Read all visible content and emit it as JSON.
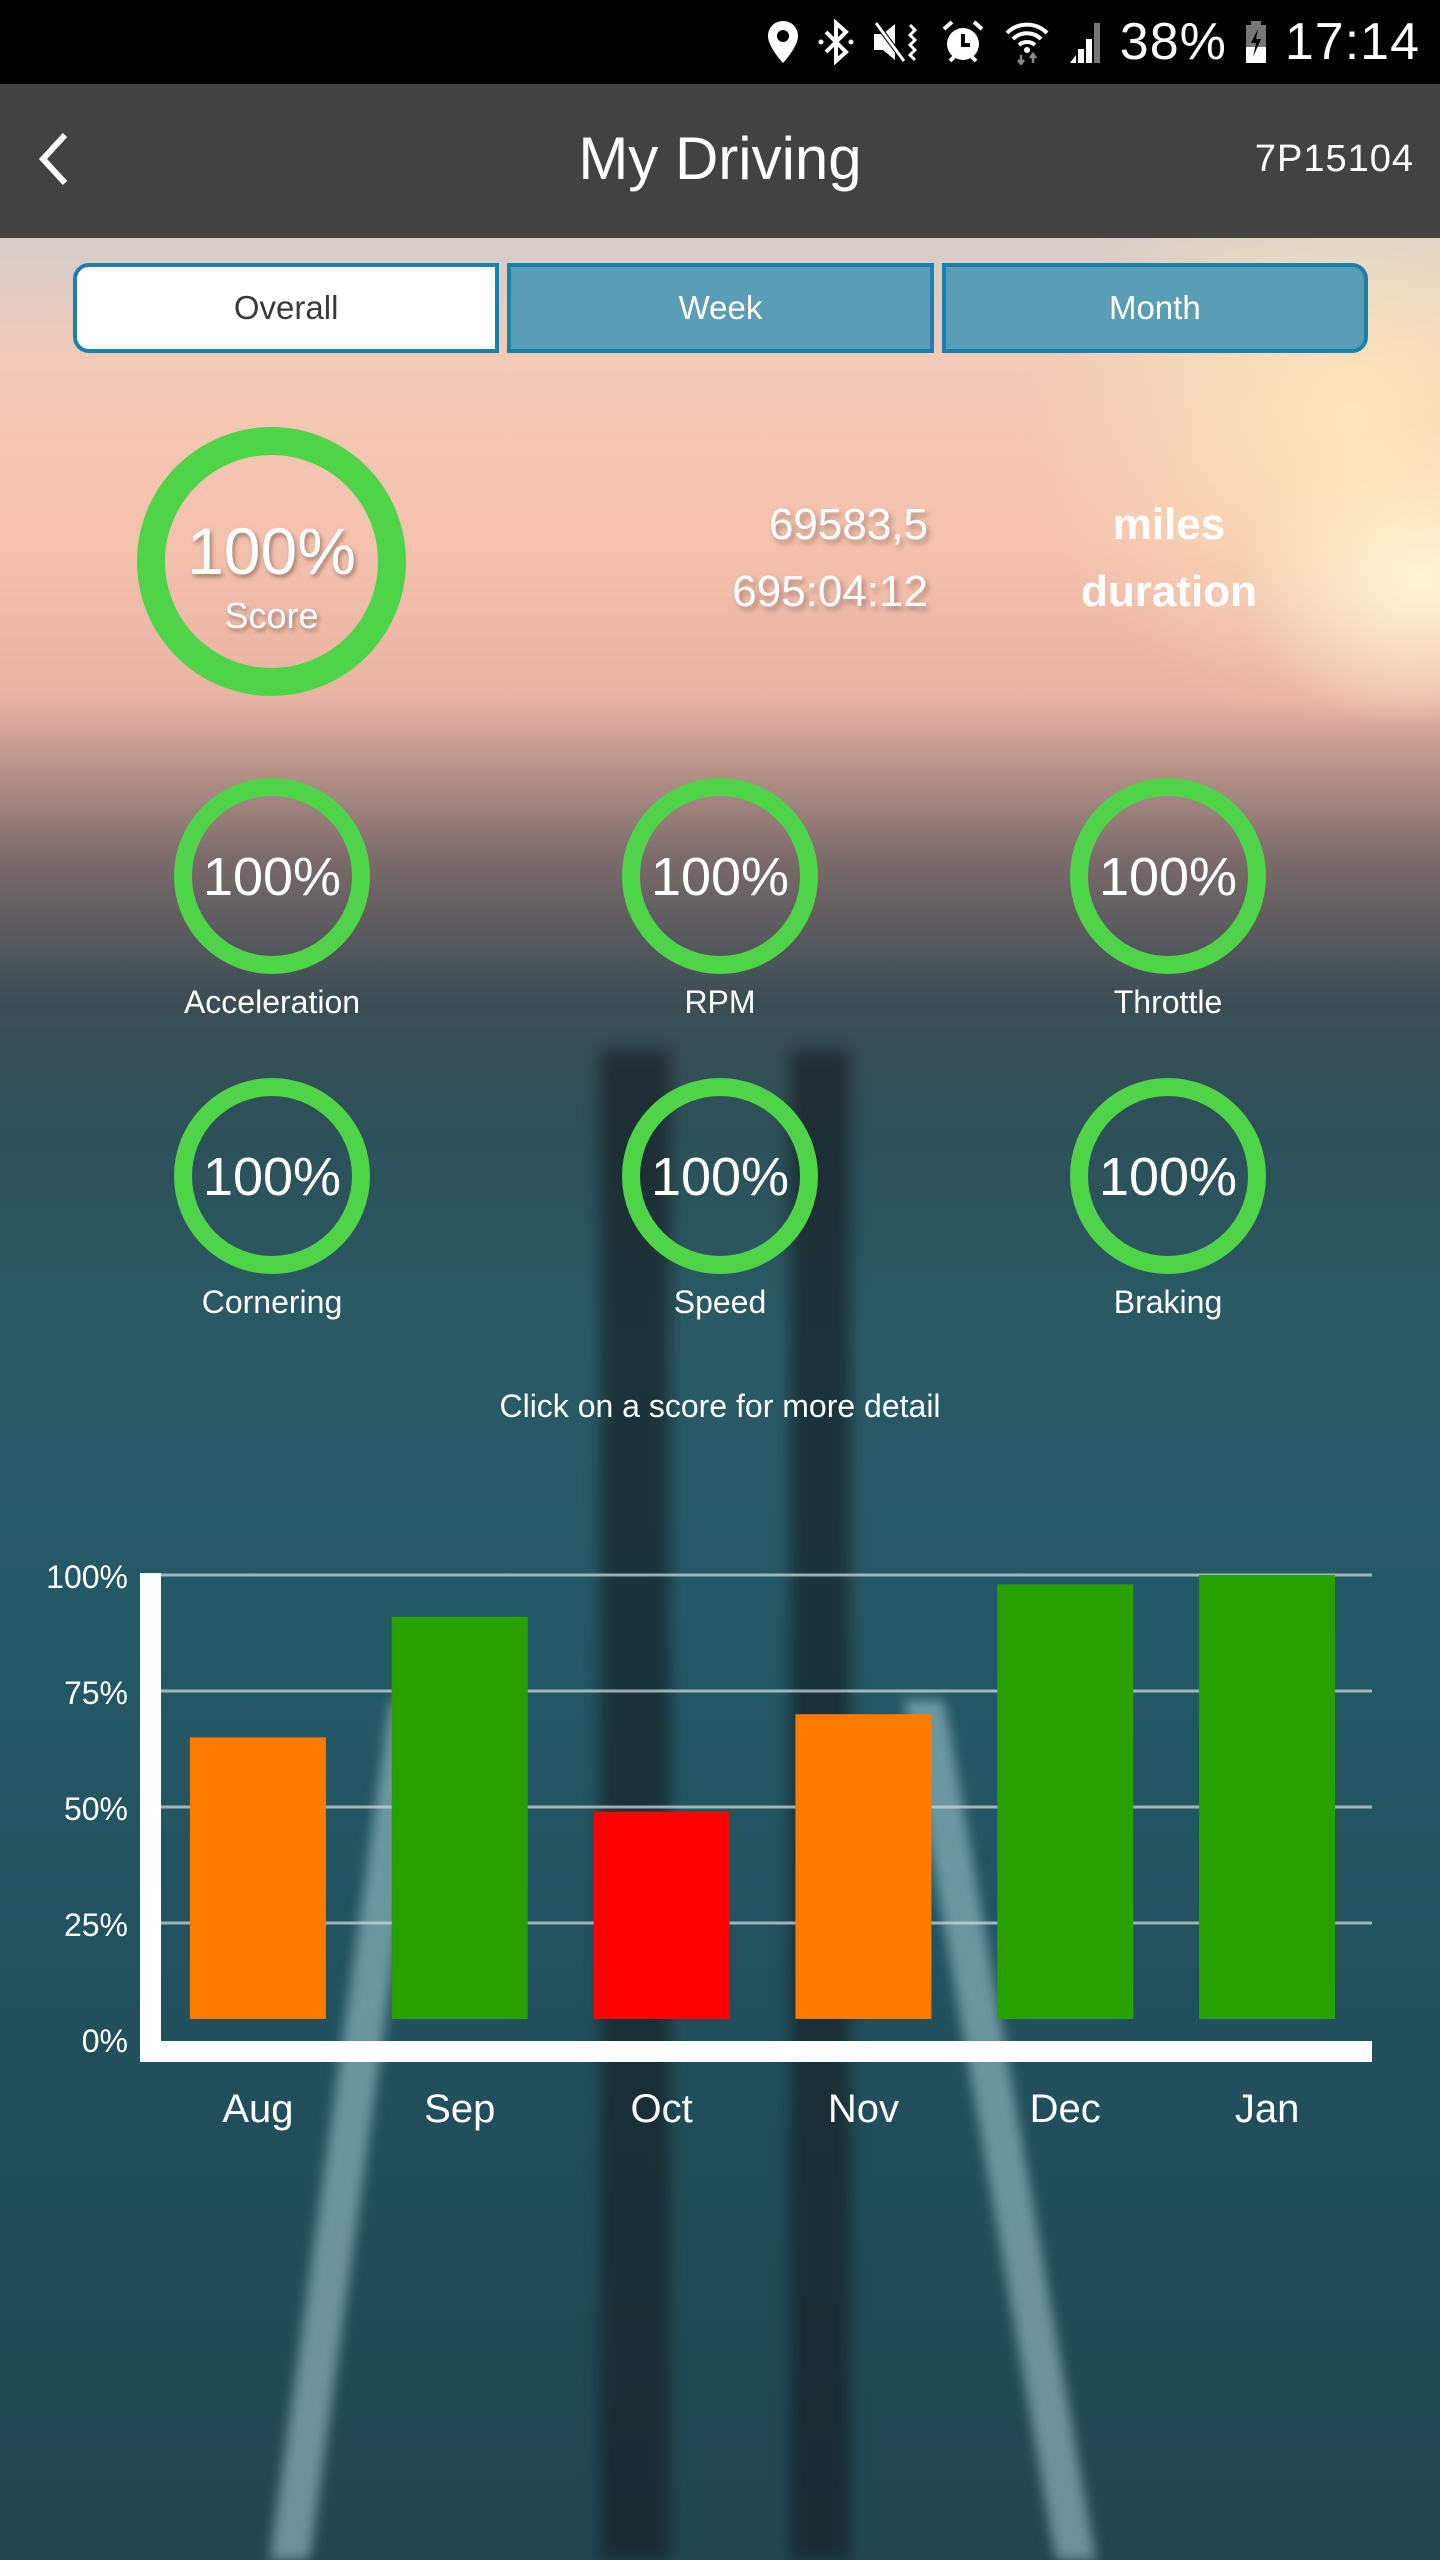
{
  "status_bar": {
    "icons": [
      "location-icon",
      "bluetooth-icon",
      "mute-vibrate-icon",
      "alarm-icon",
      "wifi-icon",
      "signal-icon"
    ],
    "battery_percent": "38%",
    "time": "17:14"
  },
  "app_bar": {
    "back_icon": "chevron-left-icon",
    "title": "My Driving",
    "vehicle_id": "7P15104"
  },
  "tabs": [
    {
      "label": "Overall",
      "active": true
    },
    {
      "label": "Week",
      "active": false
    },
    {
      "label": "Month",
      "active": false
    }
  ],
  "overall": {
    "score_value": "100%",
    "score_label": "Score",
    "distance_value": "69583,5",
    "distance_unit": "miles",
    "duration_value": "695:04:12",
    "duration_unit": "duration"
  },
  "sub_scores": [
    {
      "label": "Acceleration",
      "value": "100%"
    },
    {
      "label": "RPM",
      "value": "100%"
    },
    {
      "label": "Throttle",
      "value": "100%"
    },
    {
      "label": "Cornering",
      "value": "100%"
    },
    {
      "label": "Speed",
      "value": "100%"
    },
    {
      "label": "Braking",
      "value": "100%"
    }
  ],
  "hint": "Click on a score for more detail",
  "colors": {
    "ring_green": "#4fd348",
    "bar_good": "#28a000",
    "bar_medium": "#ff7a00",
    "bar_bad": "#ff0000",
    "app_bar": "#424242",
    "tab_inactive": "#5b9db5",
    "tab_border": "#1a82aa"
  },
  "chart_data": {
    "type": "bar",
    "title": "",
    "xlabel": "",
    "ylabel": "",
    "categories": [
      "Aug",
      "Sep",
      "Oct",
      "Nov",
      "Dec",
      "Jan"
    ],
    "values": [
      65,
      91,
      49,
      70,
      98,
      100
    ],
    "bar_colors": [
      "#ff7a00",
      "#28a000",
      "#ff0000",
      "#ff7a00",
      "#28a000",
      "#28a000"
    ],
    "ylim": [
      0,
      100
    ],
    "yticks": [
      "0%",
      "25%",
      "50%",
      "75%",
      "100%"
    ],
    "ytick_values": [
      0,
      25,
      50,
      75,
      100
    ],
    "grid": true,
    "legend": "none"
  }
}
